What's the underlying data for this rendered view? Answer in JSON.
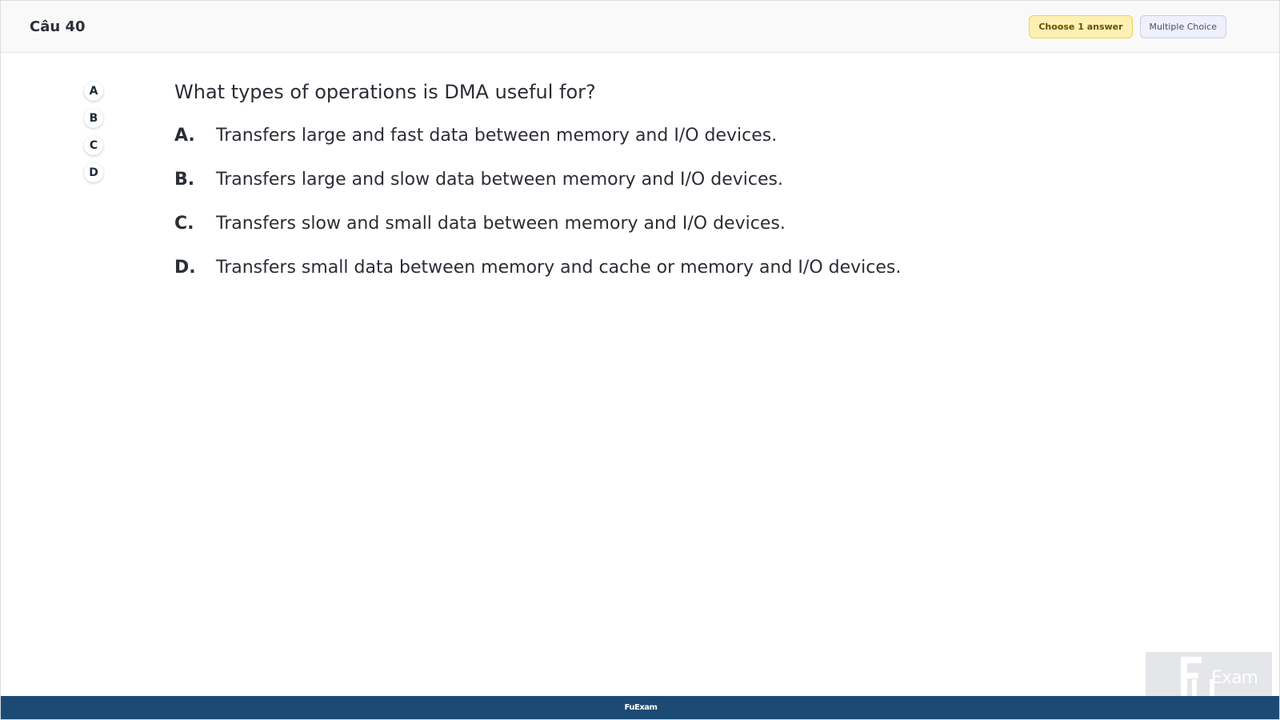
{
  "header": {
    "title": "Câu 40",
    "choose_badge": "Choose 1 answer",
    "type_badge": "Multiple Choice"
  },
  "selectors": [
    "A",
    "B",
    "C",
    "D"
  ],
  "question": {
    "text": "What types of operations is DMA useful for?",
    "options": [
      {
        "letter": "A.",
        "text": "Transfers large and fast data between memory and I/O devices."
      },
      {
        "letter": "B.",
        "text": "Transfers large and slow data between memory and I/O devices."
      },
      {
        "letter": "C.",
        "text": "Transfers slow and small data between memory and I/O devices."
      },
      {
        "letter": "D.",
        "text": "Transfers small data between memory and cache or memory and I/O devices."
      }
    ]
  },
  "footer": {
    "text": "FuExam"
  },
  "watermark": {
    "text": "Exam"
  }
}
